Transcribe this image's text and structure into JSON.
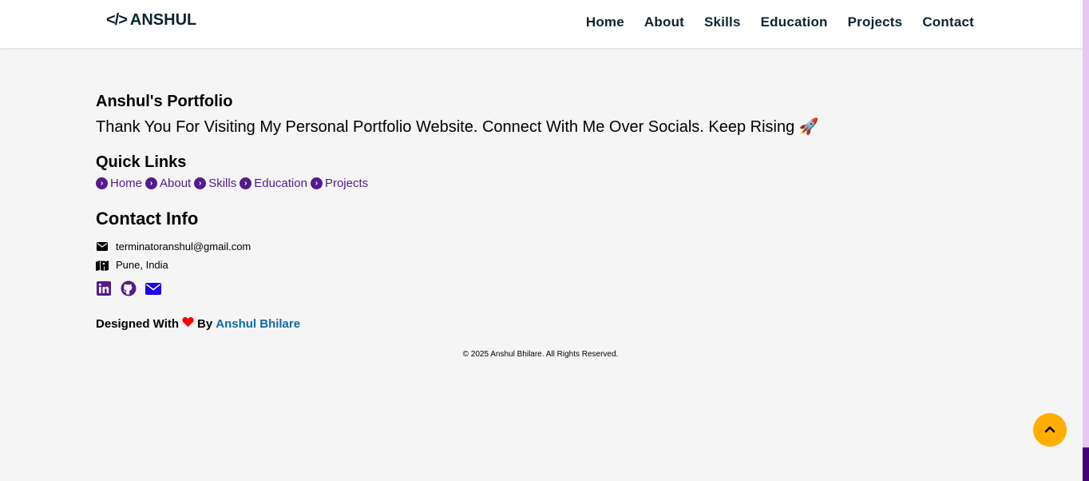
{
  "navbar": {
    "brand_icon": "</>",
    "brand_name": "ANSHUL",
    "links": [
      "Home",
      "About",
      "Skills",
      "Education",
      "Projects",
      "Contact"
    ]
  },
  "footer": {
    "title": "Anshul's Portfolio",
    "tagline": "Thank You For Visiting My Personal Portfolio Website. Connect With Me Over Socials. Keep Rising 🚀",
    "quick_links_heading": "Quick Links",
    "quick_links": [
      "Home",
      "About",
      "Skills",
      "Education",
      "Projects"
    ],
    "contact_heading": "Contact Info",
    "email": "terminatoranshul@gmail.com",
    "location": "Pune, India",
    "socials": [
      "linkedin-icon",
      "github-icon",
      "mail-icon"
    ],
    "designed_prefix": "Designed With",
    "designed_by": "By",
    "author": "Anshul Bhilare",
    "copyright": "© 2025 Anshul Bhilare. All Rights Reserved."
  },
  "colors": {
    "link": "#551a8b",
    "author": "#0e6ba8",
    "scroll_top": "#ffae00",
    "heart": "#ff0000"
  }
}
